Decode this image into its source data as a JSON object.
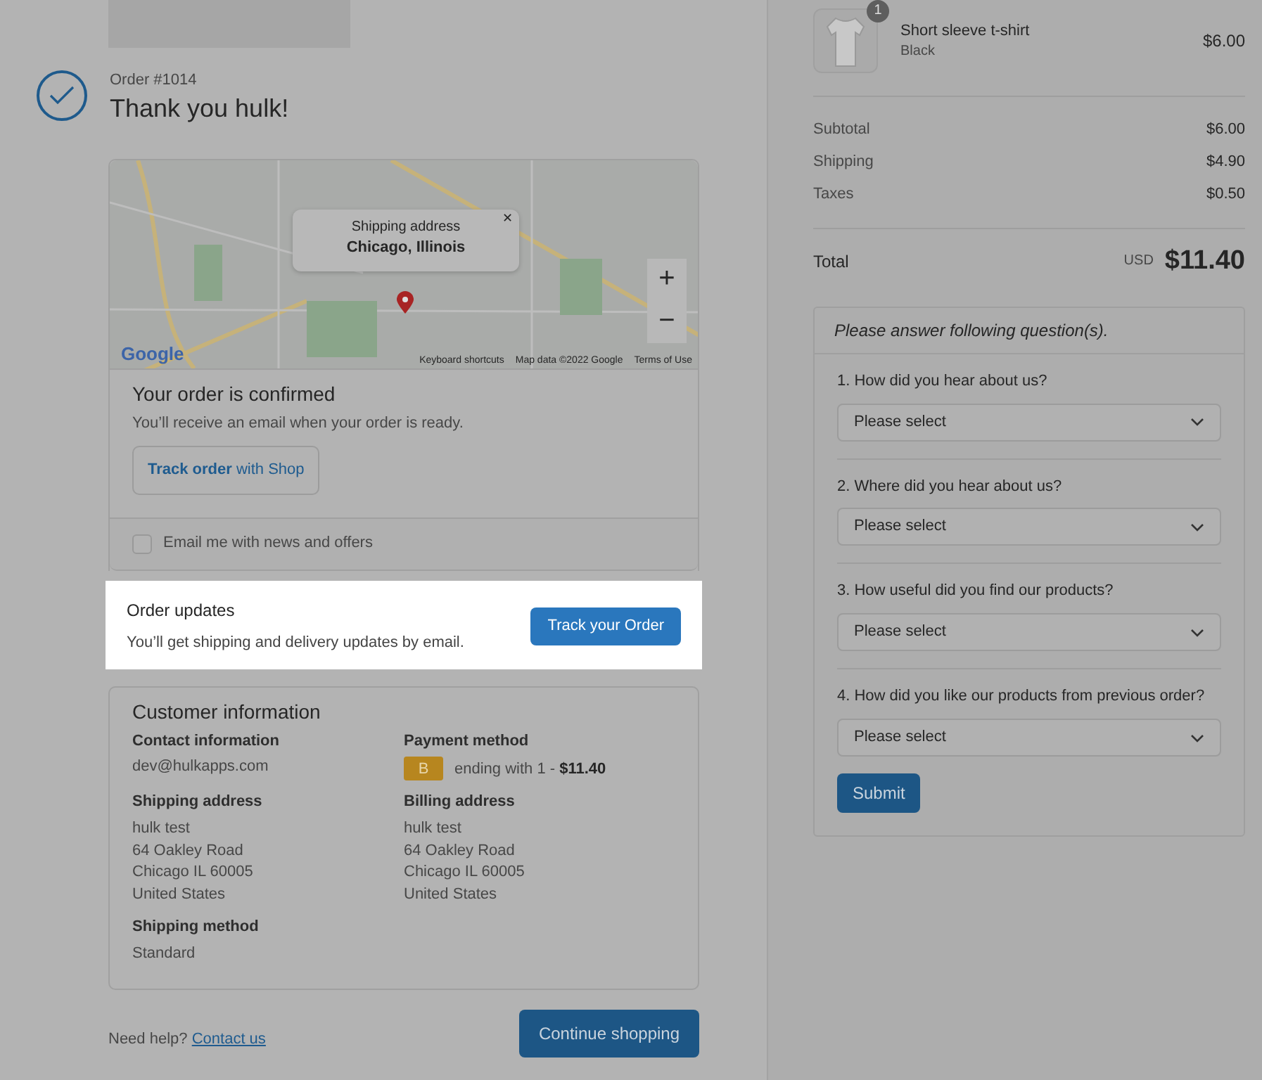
{
  "header": {
    "order_number": "Order #1014",
    "title": "Thank you hulk!"
  },
  "map": {
    "popup": {
      "label": "Shipping address",
      "place": "Chicago, Illinois",
      "close": "✕"
    },
    "logo": "Google",
    "attribution": [
      "Keyboard shortcuts",
      "Map data ©2022 Google",
      "Terms of Use"
    ],
    "zoom_in": "+",
    "zoom_out": "−"
  },
  "confirmation": {
    "title": "Your order is confirmed",
    "text": "You’ll receive an email when your order is ready.",
    "button": {
      "bold": "Track order",
      "rest": "with Shop"
    }
  },
  "newsletter": {
    "label": "Email me with news and offers",
    "checked": false
  },
  "order_updates": {
    "title": "Order updates",
    "text": "You’ll get shipping and delivery updates by email.",
    "button": "Track your Order"
  },
  "customer_info": {
    "title": "Customer information",
    "sections": [
      {
        "kind": "text",
        "heading": "Contact information",
        "lines": [
          "dev@hulkapps.com"
        ]
      },
      {
        "kind": "payment",
        "heading": "Payment method",
        "card_letter": "B",
        "text": "ending with 1 - ",
        "amount": "$11.40"
      },
      {
        "kind": "text",
        "heading": "Shipping address",
        "lines": [
          "hulk test",
          "64 Oakley Road",
          "Chicago IL 60005",
          "United States"
        ]
      },
      {
        "kind": "text",
        "heading": "Billing address",
        "lines": [
          "hulk test",
          "64 Oakley Road",
          "Chicago IL 60005",
          "United States"
        ]
      },
      {
        "kind": "text",
        "heading": "Shipping method",
        "lines": [
          "Standard"
        ]
      }
    ]
  },
  "footer": {
    "help": "Need help?",
    "link": "Contact us",
    "button": "Continue shopping"
  },
  "summary": {
    "product": {
      "quantity": "1",
      "name": "Short sleeve t-shirt",
      "variant": "Black",
      "price": "$6.00"
    },
    "lines": [
      {
        "label": "Subtotal",
        "value": "$6.00"
      },
      {
        "label": "Shipping",
        "value": "$4.90"
      },
      {
        "label": "Taxes",
        "value": "$0.50"
      }
    ],
    "total": {
      "label": "Total",
      "currency": "USD",
      "value": "$11.40"
    }
  },
  "survey": {
    "title": "Please answer following question(s).",
    "questions": [
      {
        "label": "1. How did you hear about us?",
        "value": "Please select"
      },
      {
        "label": "2. Where did you hear about us?",
        "value": "Please select"
      },
      {
        "label": "3. How useful did you find our products?",
        "value": "Please select"
      },
      {
        "label": "4. How did you like our products from previous order?",
        "value": "Please select"
      }
    ],
    "button": "Submit"
  }
}
